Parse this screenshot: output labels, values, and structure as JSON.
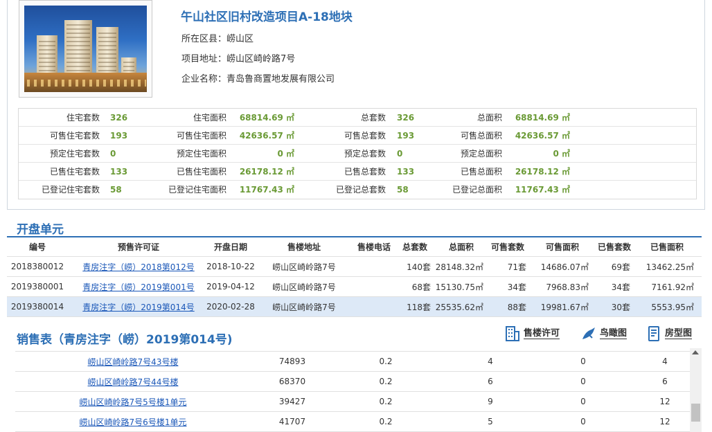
{
  "project": {
    "title": "午山社区旧村改造项目A-18地块",
    "district_label": "所在区县：",
    "district": "崂山区",
    "address_label": "项目地址：",
    "address": "崂山区崎岭路7号",
    "company_label": "企业名称：",
    "company": "青岛鲁商置地发展有限公司"
  },
  "stats": [
    [
      {
        "label": "住宅套数",
        "value": "326"
      },
      {
        "label": "住宅面积",
        "value": "68814.69 ㎡"
      },
      {
        "label": "总套数",
        "value": "326"
      },
      {
        "label": "总面积",
        "value": "68814.69 ㎡"
      }
    ],
    [
      {
        "label": "可售住宅套数",
        "value": "193"
      },
      {
        "label": "可售住宅面积",
        "value": "42636.57 ㎡"
      },
      {
        "label": "可售总套数",
        "value": "193"
      },
      {
        "label": "可售总面积",
        "value": "42636.57 ㎡"
      }
    ],
    [
      {
        "label": "预定住宅套数",
        "value": "0"
      },
      {
        "label": "预定住宅面积",
        "value": "0 ㎡"
      },
      {
        "label": "预定总套数",
        "value": "0"
      },
      {
        "label": "预定总面积",
        "value": "0 ㎡"
      }
    ],
    [
      {
        "label": "已售住宅套数",
        "value": "133"
      },
      {
        "label": "已售住宅面积",
        "value": "26178.12 ㎡"
      },
      {
        "label": "已售总套数",
        "value": "133"
      },
      {
        "label": "已售总面积",
        "value": "26178.12 ㎡"
      }
    ],
    [
      {
        "label": "已登记住宅套数",
        "value": "58"
      },
      {
        "label": "已登记住宅面积",
        "value": "11767.43 ㎡"
      },
      {
        "label": "已登记总套数",
        "value": "58"
      },
      {
        "label": "已登记总面积",
        "value": "11767.43 ㎡"
      }
    ]
  ],
  "units_section_title": "开盘单元",
  "units_table": {
    "headers": [
      "编号",
      "预售许可证",
      "开盘日期",
      "售楼地址",
      "售楼电话",
      "总套数",
      "总面积",
      "可售套数",
      "可售面积",
      "已售套数",
      "已售面积"
    ],
    "rows": [
      [
        "2018380012",
        "青房注字（崂）2018第012号",
        "2018-10-22",
        "崂山区崎岭路7号",
        "",
        "140套",
        "28148.32㎡",
        "71套",
        "14686.07㎡",
        "69套",
        "13462.25㎡"
      ],
      [
        "2019380001",
        "青房注字（崂）2019第001号",
        "2019-04-12",
        "崂山区崎岭路7号",
        "",
        "68套",
        "15130.75㎡",
        "34套",
        "7968.83㎡",
        "34套",
        "7161.92㎡"
      ],
      [
        "2019380014",
        "青房注字（崂）2019第014号",
        "2020-02-28",
        "崂山区崎岭路7号",
        "",
        "118套",
        "25535.62㎡",
        "88套",
        "19981.67㎡",
        "30套",
        "5553.95㎡"
      ]
    ],
    "selected_index": 2
  },
  "sales_section_title": "销售表（青房注字（崂）2019第014号)",
  "tools": {
    "permit": "售楼许可",
    "aerial": "鸟瞰图",
    "floorplan": "房型图"
  },
  "sales_table": {
    "rows": [
      [
        "崂山区崎岭路7号43号楼",
        "74893",
        "0.2",
        "4",
        "0",
        "4"
      ],
      [
        "崂山区崎岭路7号44号楼",
        "68370",
        "0.2",
        "6",
        "0",
        "6"
      ],
      [
        "崂山区崎岭路7号5号楼1单元",
        "39427",
        "0.2",
        "9",
        "0",
        "12"
      ],
      [
        "崂山区崎岭路7号6号楼1单元",
        "41707",
        "0.2",
        "5",
        "0",
        "12"
      ]
    ]
  },
  "colors": {
    "accent": "#2d6fb5",
    "value_green": "#6a9a35",
    "link": "#1a57b8",
    "selected_row": "#dde9f7"
  }
}
